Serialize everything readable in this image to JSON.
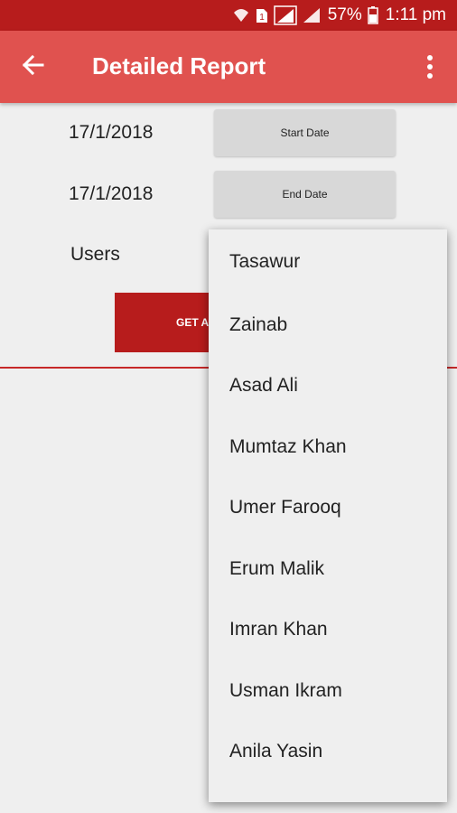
{
  "status_bar": {
    "battery": "57%",
    "time": "1:11 pm",
    "sim_label": "1",
    "icons": [
      "wifi-icon",
      "sim-icon",
      "signal-icon",
      "signal-icon",
      "battery-icon"
    ]
  },
  "app_bar": {
    "title": "Detailed Report",
    "back_icon": "arrow-left-icon",
    "menu_icon": "more-vertical-icon"
  },
  "form": {
    "start_date": "17/1/2018",
    "start_button": "Start Date",
    "end_date": "17/1/2018",
    "end_button": "End Date",
    "users_label": "Users",
    "get_button_visible": "GET A"
  },
  "users_dropdown": {
    "options": [
      "Tasawur",
      "Zainab",
      "Asad Ali",
      "Mumtaz Khan",
      "Umer Farooq",
      "Erum Malik",
      "Imran Khan",
      "Usman Ikram",
      "Anila Yasin"
    ]
  },
  "colors": {
    "status_bar": "#b71c1c",
    "app_bar": "#e0524f",
    "accent": "#b71c1c",
    "background": "#efefef"
  }
}
